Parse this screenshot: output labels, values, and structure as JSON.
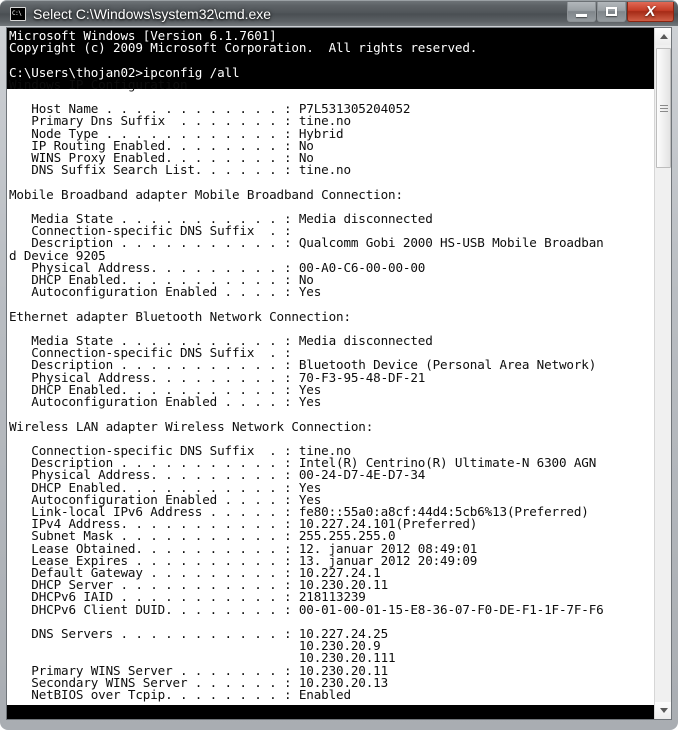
{
  "window": {
    "title": "Select C:\\Windows\\system32\\cmd.exe",
    "icon": "cmd-console-icon",
    "colors": {
      "titlebar": "#4f5458",
      "close_button": "#c43c26",
      "console_background": "#ffffff",
      "console_foreground": "#0d0d0d",
      "selection_background": "#000000",
      "selection_foreground": "#ffffff"
    }
  },
  "caption_buttons": {
    "minimize_label": "Minimize",
    "maximize_label": "Maximize",
    "close_label": "Close",
    "close_glyph": "X"
  },
  "scrollbar": {
    "up_arrow_label": "Scroll up",
    "down_arrow_label": "Scroll down",
    "thumb_label": "Vertical scroll thumb"
  },
  "console": {
    "selected_text": "Microsoft Windows [Version 6.1.7601]\nCopyright (c) 2009 Microsoft Corporation.  All rights reserved.\n\nC:\\Users\\thojan02>ipconfig /all",
    "output_text": "\nWindows IP Configuration\n\n   Host Name . . . . . . . . . . . . : P7L531305204052\n   Primary Dns Suffix  . . . . . . . : tine.no\n   Node Type . . . . . . . . . . . . : Hybrid\n   IP Routing Enabled. . . . . . . . : No\n   WINS Proxy Enabled. . . . . . . . : No\n   DNS Suffix Search List. . . . . . : tine.no\n\nMobile Broadband adapter Mobile Broadband Connection:\n\n   Media State . . . . . . . . . . . : Media disconnected\n   Connection-specific DNS Suffix  . :\n   Description . . . . . . . . . . . : Qualcomm Gobi 2000 HS-USB Mobile Broadban\nd Device 9205\n   Physical Address. . . . . . . . . : 00-A0-C6-00-00-00\n   DHCP Enabled. . . . . . . . . . . : No\n   Autoconfiguration Enabled . . . . : Yes\n\nEthernet adapter Bluetooth Network Connection:\n\n   Media State . . . . . . . . . . . : Media disconnected\n   Connection-specific DNS Suffix  . :\n   Description . . . . . . . . . . . : Bluetooth Device (Personal Area Network)\n   Physical Address. . . . . . . . . : 70-F3-95-48-DF-21\n   DHCP Enabled. . . . . . . . . . . : Yes\n   Autoconfiguration Enabled . . . . : Yes\n\nWireless LAN adapter Wireless Network Connection:\n\n   Connection-specific DNS Suffix  . : tine.no\n   Description . . . . . . . . . . . : Intel(R) Centrino(R) Ultimate-N 6300 AGN\n   Physical Address. . . . . . . . . : 00-24-D7-4E-D7-34\n   DHCP Enabled. . . . . . . . . . . : Yes\n   Autoconfiguration Enabled . . . . : Yes\n   Link-local IPv6 Address . . . . . : fe80::55a0:a8cf:44d4:5cb6%13(Preferred)\n   IPv4 Address. . . . . . . . . . . : 10.227.24.101(Preferred)\n   Subnet Mask . . . . . . . . . . . : 255.255.255.0\n   Lease Obtained. . . . . . . . . . : 12. januar 2012 08:49:01\n   Lease Expires . . . . . . . . . . : 13. januar 2012 20:49:09\n   Default Gateway . . . . . . . . . : 10.227.24.1\n   DHCP Server . . . . . . . . . . . : 10.230.20.11\n   DHCPv6 IAID . . . . . . . . . . . : 218113239\n   DHCPv6 Client DUID. . . . . . . . : 00-01-00-01-15-E8-36-07-F0-DE-F1-1F-7F-F6\n\n   DNS Servers . . . . . . . . . . . : 10.227.24.25\n                                       10.230.20.9\n                                       10.230.20.111\n   Primary WINS Server . . . . . . . : 10.230.20.11\n   Secondary WINS Server . . . . . . : 10.230.20.13\n   NetBIOS over Tcpip. . . . . . . . : Enabled"
  }
}
